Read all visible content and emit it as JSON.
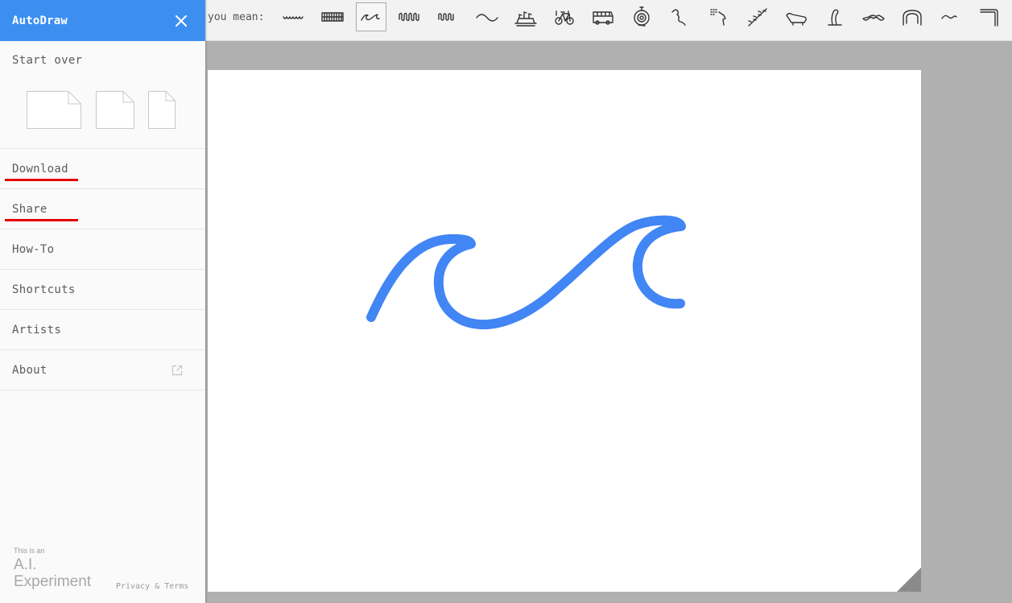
{
  "app": {
    "title": "AutoDraw"
  },
  "sidebar": {
    "start_over": "Start over",
    "menu": [
      {
        "label": "Download",
        "highlighted": true
      },
      {
        "label": "Share",
        "highlighted": true
      },
      {
        "label": "How-To"
      },
      {
        "label": "Shortcuts"
      },
      {
        "label": "Artists"
      },
      {
        "label": "About",
        "icon": "external-link-icon"
      }
    ],
    "footer": {
      "small": "This is an",
      "line1": "A.I.",
      "line2": "Experiment",
      "links": "Privacy & Terms"
    }
  },
  "suggestions": {
    "label": "you mean:",
    "selected_index": 2,
    "items": [
      "squiggle-icon",
      "fence-icon",
      "wave-icon",
      "spring-icon",
      "coil-icon",
      "tilde-icon",
      "boat-icon",
      "bicycle-icon",
      "bus-icon",
      "spiral-icon",
      "worm-icon",
      "shower-icon",
      "vine-icon",
      "bathtub-icon",
      "cobra-icon",
      "mustache-icon",
      "arch-icon",
      "wave-line-icon",
      "corner-icon"
    ]
  },
  "colors": {
    "accent": "#3c8ff0",
    "stroke": "#4285f4",
    "highlight": "#e60000"
  }
}
